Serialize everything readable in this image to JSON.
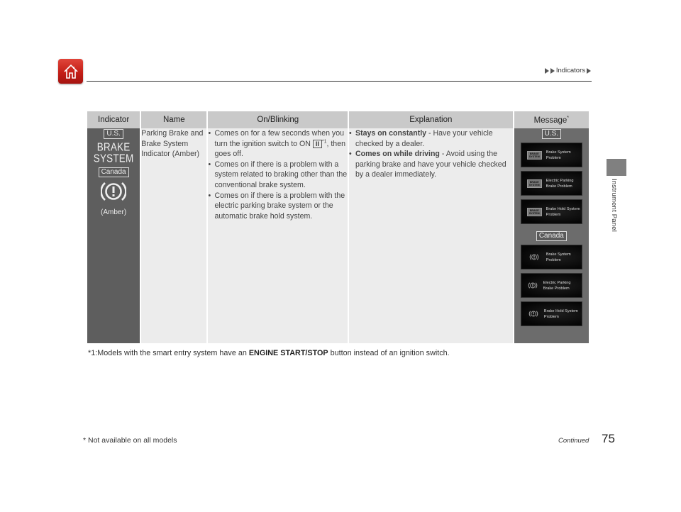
{
  "header": {
    "home_icon": "home-icon",
    "breadcrumb": "Indicators"
  },
  "side_tab": {
    "label": "Instrument Panel"
  },
  "table": {
    "columns": [
      "Indicator",
      "Name",
      "On/Blinking",
      "Explanation",
      "Message"
    ],
    "message_footnote_mark": "*",
    "row": {
      "indicator": {
        "us_tag": "U.S.",
        "us_symbol_line1": "BRAKE",
        "us_symbol_line2": "SYSTEM",
        "canada_tag": "Canada",
        "canada_symbol": "brake-warning-icon",
        "color_note": "(Amber)"
      },
      "name": "Parking Brake and Brake System Indicator (Amber)",
      "on_blinking": [
        {
          "before": "Comes on for a few seconds when you turn the ignition switch to ON ",
          "key": "II",
          "sup": "*1",
          "after": ", then goes off."
        },
        {
          "text": "Comes on if there is a problem with a system related to braking other than the conventional brake system."
        },
        {
          "text": "Comes on if there is a problem with the electric parking brake system or the automatic brake hold system."
        }
      ],
      "explanation": [
        {
          "bold": "Stays on constantly",
          "text": " - Have your vehicle checked by a dealer."
        },
        {
          "bold": "Comes on while driving",
          "text": " - Avoid using the parking brake and have your vehicle checked by a dealer immediately."
        }
      ],
      "messages": {
        "us_tag": "U.S.",
        "us_icon_text": "BRAKE SYSTEM",
        "us": [
          "Brake System Problem",
          "Electric Parking Brake Problem",
          "Brake Hold System Problem"
        ],
        "canada_tag": "Canada",
        "canada": [
          "Brake System Problem",
          "Electric Parking Brake Problem",
          "Brake Hold System Problem"
        ]
      }
    }
  },
  "footnote": {
    "prefix": "*1:Models with the smart entry system have an ",
    "bold": "ENGINE START/STOP",
    "suffix": " button instead of an ignition switch."
  },
  "bottom_note": "* Not available on all models",
  "continued": "Continued",
  "page_number": "75"
}
